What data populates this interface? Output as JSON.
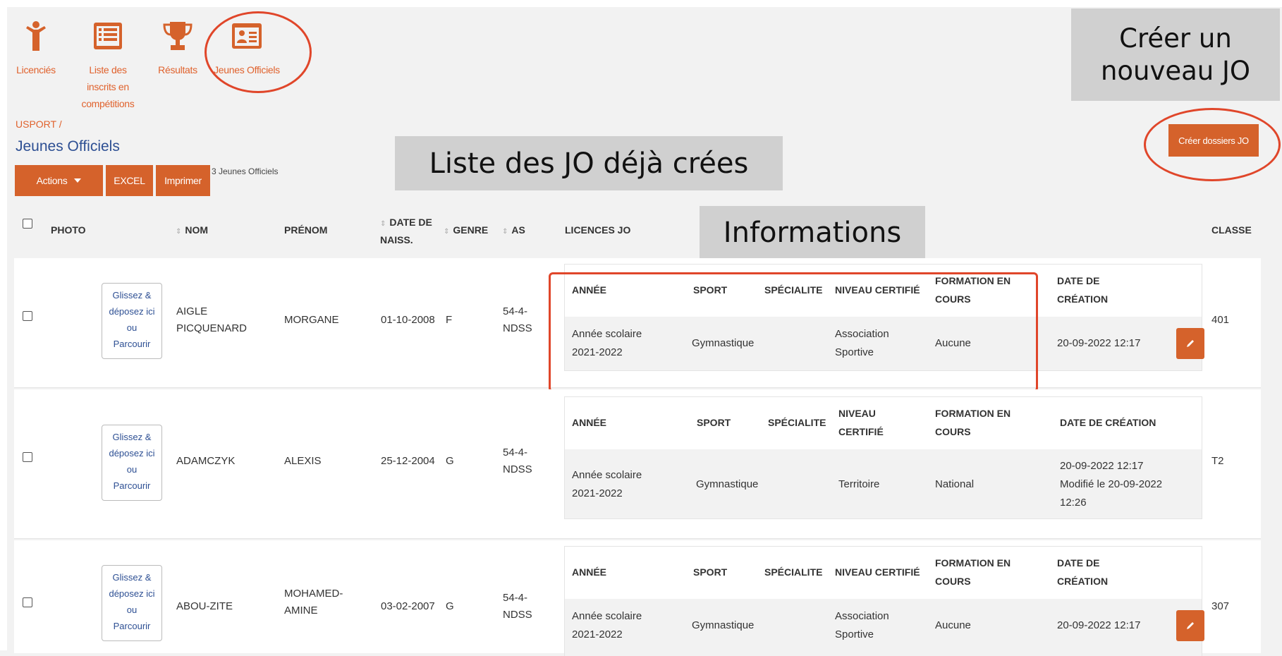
{
  "nav": {
    "items": [
      {
        "label": "Licenciés"
      },
      {
        "label": "Liste des inscrits en compétitions"
      },
      {
        "label": "Résultats"
      },
      {
        "label": "Jeunes Officiels"
      }
    ]
  },
  "breadcrumb": "USPORT /",
  "page_title": "Jeunes Officiels",
  "toolbar": {
    "actions": "Actions",
    "excel": "EXCEL",
    "print": "Imprimer",
    "count": "3 Jeunes Officiels"
  },
  "create_button": "Créer dossiers JO",
  "callouts": {
    "create_new": "Créer un nouveau JO",
    "list": "Liste des JO déjà crées",
    "info": "Informations"
  },
  "columns": {
    "photo": "PHOTO",
    "nom": "NOM",
    "prenom": "PRÉNOM",
    "date": "DATE DE NAISS.",
    "genre": "GENRE",
    "as": "AS",
    "licences": "LICENCES JO",
    "classe": "CLASSE"
  },
  "dropzone": {
    "line1": "Glissez &",
    "line2": "déposez ici",
    "line3": "ou",
    "line4": "Parcourir"
  },
  "rows": [
    {
      "nom": "AIGLE PICQUENARD",
      "prenom": "MORGANE",
      "date": "01-10-2008",
      "genre": "F",
      "as": "54-4-NDSS",
      "classe": "401",
      "lic_headers": {
        "annee": "ANNÉE",
        "sport": "SPORT",
        "specialite": "SPÉCIALITE",
        "niveau": "NIVEAU CERTIFIÉ",
        "formation": "FORMATION EN COURS",
        "creation": "DATE DE CRÉATION"
      },
      "lic": {
        "annee": "Année scolaire 2021-2022",
        "sport": "Gymnastique",
        "specialite": "",
        "niveau": "Association Sportive",
        "formation": "Aucune",
        "creation": "20-09-2022 12:17",
        "modifie": ""
      }
    },
    {
      "nom": "ADAMCZYK",
      "prenom": "ALEXIS",
      "date": "25-12-2004",
      "genre": "G",
      "as": "54-4-NDSS",
      "classe": "T2",
      "lic_headers": {
        "annee": "ANNÉE",
        "sport": "SPORT",
        "specialite": "SPÉCIALITE",
        "niveau": "NIVEAU CERTIFIÉ",
        "formation": "FORMATION EN COURS",
        "creation": "DATE DE CRÉATION"
      },
      "lic": {
        "annee": "Année scolaire 2021-2022",
        "sport": "Gymnastique",
        "specialite": "",
        "niveau": "Territoire",
        "formation": "National",
        "creation": "20-09-2022 12:17",
        "modifie": "Modifié le 20-09-2022 12:26"
      }
    },
    {
      "nom": "ABOU-ZITE",
      "prenom": "MOHAMED-AMINE",
      "date": "03-02-2007",
      "genre": "G",
      "as": "54-4-NDSS",
      "classe": "307",
      "lic_headers": {
        "annee": "ANNÉE",
        "sport": "SPORT",
        "specialite": "SPÉCIALITE",
        "niveau": "NIVEAU CERTIFIÉ",
        "formation": "FORMATION EN COURS",
        "creation": "DATE DE CRÉATION"
      },
      "lic": {
        "annee": "Année scolaire 2021-2022",
        "sport": "Gymnastique",
        "specialite": "",
        "niveau": "Association Sportive",
        "formation": "Aucune",
        "creation": "20-09-2022 12:17",
        "modifie": ""
      }
    }
  ],
  "colors": {
    "accent": "#d5622b",
    "title": "#2d4f93",
    "annotation": "#e0462a"
  },
  "icons": [
    "person-icon",
    "list-icon",
    "trophy-icon",
    "id-card-icon",
    "pencil-icon",
    "caret-down-icon"
  ]
}
